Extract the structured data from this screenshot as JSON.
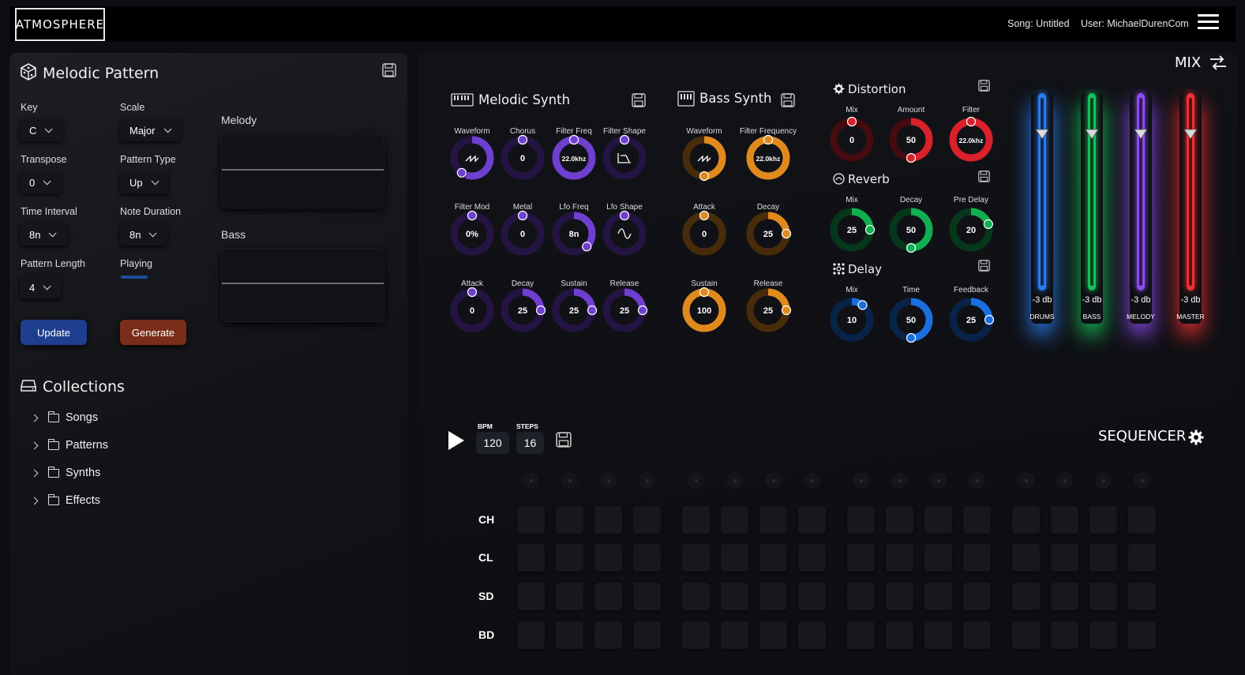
{
  "header": {
    "logo": "ATMOSPHERE",
    "song": "Song: Untitled",
    "user": "User: MichaelDurenCom"
  },
  "pattern": {
    "title": "Melodic Pattern",
    "key_label": "Key",
    "key_value": "C",
    "scale_label": "Scale",
    "scale_value": "Major",
    "transpose_label": "Transpose",
    "transpose_value": "0",
    "pattern_type_label": "Pattern Type",
    "pattern_type_value": "Up",
    "time_interval_label": "Time Interval",
    "time_interval_value": "8n",
    "note_duration_label": "Note Duration",
    "note_duration_value": "8n",
    "pattern_length_label": "Pattern Length",
    "pattern_length_value": "4",
    "playing_label": "Playing",
    "update_label": "Update",
    "generate_label": "Generate",
    "melody_label": "Melody",
    "bass_label": "Bass"
  },
  "collections": {
    "title": "Collections",
    "items": [
      "Songs",
      "Patterns",
      "Synths",
      "Effects"
    ]
  },
  "mix": {
    "label": "MIX"
  },
  "melodic_synth": {
    "title": "Melodic Synth",
    "knobs": [
      {
        "label": "Waveform",
        "value": "",
        "icon": "saw-wave-icon"
      },
      {
        "label": "Chorus",
        "value": "0"
      },
      {
        "label": "Filter Freq",
        "value": "22.0khz"
      },
      {
        "label": "Filter Shape",
        "value": "",
        "icon": "lowpass-shape-icon"
      },
      {
        "label": "Filter Mod",
        "value": "0%"
      },
      {
        "label": "Metal",
        "value": "0"
      },
      {
        "label": "Lfo Freq",
        "value": "8n"
      },
      {
        "label": "Lfo Shape",
        "value": "",
        "icon": "sine-wave-icon"
      },
      {
        "label": "Attack",
        "value": "0"
      },
      {
        "label": "Decay",
        "value": "25"
      },
      {
        "label": "Sustain",
        "value": "25"
      },
      {
        "label": "Release",
        "value": "25"
      }
    ],
    "color": "#6f3fd0"
  },
  "bass_synth": {
    "title": "Bass Synth",
    "knobs": [
      {
        "label": "Waveform",
        "value": "",
        "icon": "saw-wave-icon"
      },
      {
        "label": "Filter Frequency",
        "value": "22.0khz"
      },
      {
        "label": "Attack",
        "value": "0"
      },
      {
        "label": "Decay",
        "value": "25"
      },
      {
        "label": "Sustain",
        "value": "100"
      },
      {
        "label": "Release",
        "value": "25"
      }
    ],
    "color": "#e08a1e"
  },
  "distortion": {
    "title": "Distortion",
    "knobs": [
      {
        "label": "Mix",
        "value": "0"
      },
      {
        "label": "Amount",
        "value": "50"
      },
      {
        "label": "Filter",
        "value": "22.0khz"
      }
    ],
    "color": "#d9212b"
  },
  "reverb": {
    "title": "Reverb",
    "knobs": [
      {
        "label": "Mix",
        "value": "25"
      },
      {
        "label": "Decay",
        "value": "50"
      },
      {
        "label": "Pre Delay",
        "value": "20"
      }
    ],
    "color": "#10b050"
  },
  "delay": {
    "title": "Delay",
    "knobs": [
      {
        "label": "Mix",
        "value": "10"
      },
      {
        "label": "Time",
        "value": "50"
      },
      {
        "label": "Feedback",
        "value": "25"
      }
    ],
    "color": "#1a6ee0"
  },
  "faders": [
    {
      "level": "-3 db",
      "name": "DRUMS",
      "color": "#2a7cf0"
    },
    {
      "level": "-3 db",
      "name": "BASS",
      "color": "#17c05a"
    },
    {
      "level": "-3 db",
      "name": "MELODY",
      "color": "#8c4cf0"
    },
    {
      "level": "-3 db",
      "name": "MASTER",
      "color": "#ef3030"
    }
  ],
  "sequencer": {
    "title": "SEQUENCER",
    "bpm_label": "BPM",
    "bpm_value": "120",
    "steps_label": "STEPS",
    "steps_value": "16",
    "rows": [
      "CH",
      "CL",
      "SD",
      "BD"
    ]
  }
}
